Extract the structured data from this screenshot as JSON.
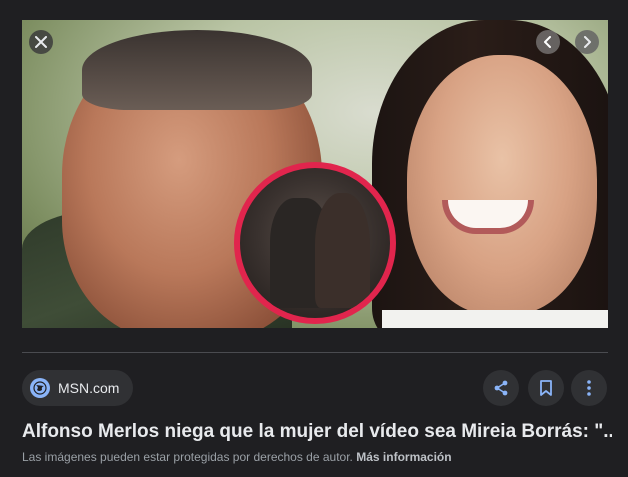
{
  "viewer": {
    "close_icon": "close-icon",
    "prev_icon": "chevron-left-icon",
    "next_icon": "chevron-right-icon"
  },
  "source": {
    "icon": "globe-icon",
    "label": "MSN.com"
  },
  "actions": {
    "share_icon": "share-icon",
    "save_icon": "bookmark-icon",
    "more_icon": "more-vert-icon"
  },
  "title": "Alfonso Merlos niega que la mujer del vídeo sea Mireia Borrás: \"...",
  "copyright": {
    "text": "Las imágenes pueden estar protegidas por derechos de autor.",
    "link": "Más información"
  },
  "colors": {
    "background": "#1f1f22",
    "chip": "#303134",
    "accent": "#8ab4f8",
    "inset_ring": "#e1254d"
  }
}
